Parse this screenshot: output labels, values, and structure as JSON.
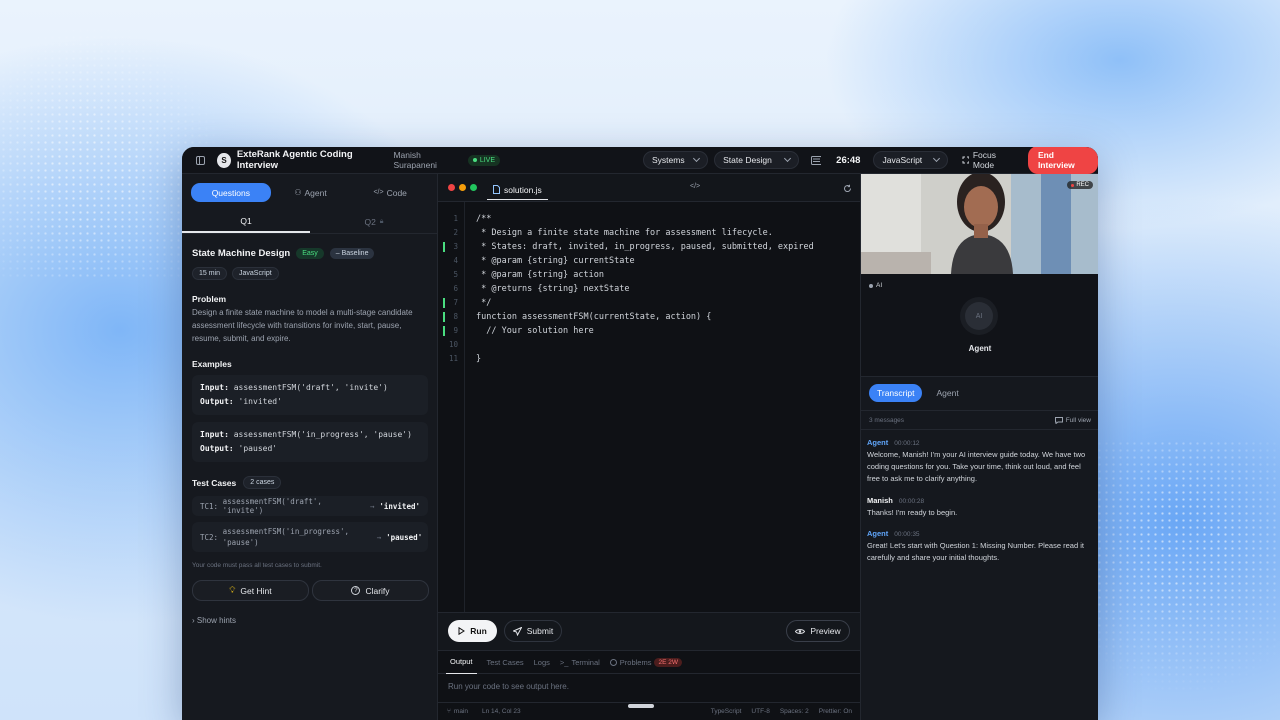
{
  "header": {
    "logo_letter": "S",
    "title": "ExteRank Agentic Coding Interview",
    "candidate": "Manish Surapaneni",
    "live": "LIVE",
    "topic_select": "Systems",
    "subtopic_select": "State Design",
    "timer": "26:48",
    "language_select": "JavaScript",
    "focus_mode": "Focus Mode",
    "end_button": "End Interview"
  },
  "left": {
    "tabs": [
      "Questions",
      "Agent",
      "Code"
    ],
    "question_tabs": [
      "Q1",
      "Q2"
    ],
    "title": "State Machine Design",
    "difficulty": "Easy",
    "baseline": "Baseline",
    "duration": "15 min",
    "language": "JavaScript",
    "problem_heading": "Problem",
    "problem_text": "Design a finite state machine to model a multi-stage candidate assessment lifecycle with transitions for invite, start, pause, resume, submit, and expire.",
    "examples_heading": "Examples",
    "examples": [
      {
        "input_label": "Input:",
        "input": "assessmentFSM('draft', 'invite')",
        "output_label": "Output:",
        "output": "'invited'"
      },
      {
        "input_label": "Input:",
        "input": "assessmentFSM('in_progress', 'pause')",
        "output_label": "Output:",
        "output": "'paused'"
      }
    ],
    "tests_heading": "Test Cases",
    "tests_count": "2 cases",
    "tests": [
      {
        "label": "TC1:",
        "call": "assessmentFSM('draft', 'invite')",
        "arrow": "→",
        "result": "'invited'"
      },
      {
        "label": "TC2:",
        "call": "assessmentFSM('in_progress', 'pause')",
        "arrow": "→",
        "result": "'paused'"
      }
    ],
    "note": "Your code must pass all test cases to submit.",
    "hint_button": "Get Hint",
    "clarify_button": "Clarify",
    "show_hints": "› Show hints"
  },
  "editor": {
    "file": "solution.js",
    "lines": [
      "/**",
      " * Design a finite state machine for assessment lifecycle.",
      " * States: draft, invited, in_progress, paused, submitted, expired",
      " * @param {string} currentState",
      " * @param {string} action",
      " * @returns {string} nextState",
      " */",
      "function assessmentFSM(currentState, action) {",
      "  // Your solution here",
      "",
      "}"
    ],
    "run": "Run",
    "submit": "Submit",
    "preview": "Preview",
    "output_tabs": [
      "Output",
      "Test Cases",
      "Logs",
      "Terminal",
      "Problems"
    ],
    "problems_badge": "2E 2W",
    "output_placeholder": "Run your code to see output here.",
    "status": {
      "branch": "main",
      "position": "Ln 14, Col 23",
      "lang": "TypeScript",
      "encoding": "UTF-8",
      "spaces": "Spaces: 2",
      "prettier": "Prettier: On"
    }
  },
  "right": {
    "rec": "REC",
    "ai_label": "AI",
    "ai_avatar": "AI",
    "agent_name": "Agent",
    "tabs": [
      "Transcript",
      "Agent"
    ],
    "message_count": "3 messages",
    "full_view": "Full view",
    "messages": [
      {
        "who": "Agent",
        "time": "00:00:12",
        "text": "Welcome, Manish! I'm your AI interview guide today. We have two coding questions for you. Take your time, think out loud, and feel free to ask me to clarify anything."
      },
      {
        "who": "Manish",
        "time": "00:00:28",
        "text": "Thanks! I'm ready to begin."
      },
      {
        "who": "Agent",
        "time": "00:00:35",
        "text": "Great! Let's start with Question 1: Missing Number. Please read it carefully and share your initial thoughts."
      }
    ]
  },
  "colors": {
    "accent": "#3b82f6",
    "danger": "#ef4444",
    "success": "#4ade80",
    "agent_name": "#60a5fa"
  }
}
